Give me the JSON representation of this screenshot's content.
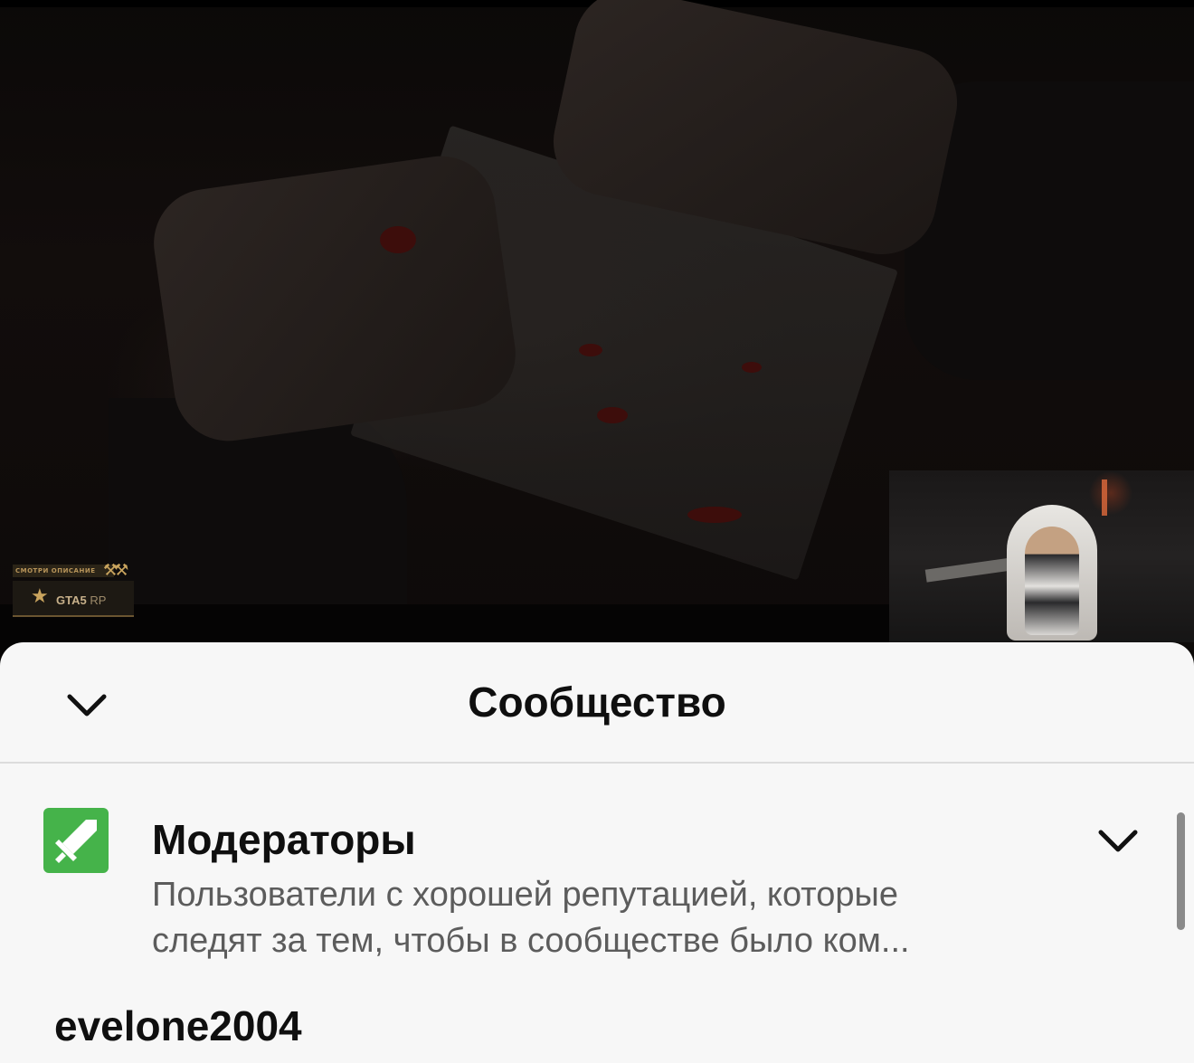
{
  "video": {
    "watermark": {
      "top_text": "СМОТРИ ОПИСАНИЕ",
      "brand": "GTA5",
      "brand_sub": "RP"
    }
  },
  "sheet": {
    "title": "Сообщество",
    "collapse_icon": "chevron-down-icon",
    "section": {
      "icon": "sword-badge-icon",
      "icon_color": "#45b34a",
      "title": "Модераторы",
      "description_line1": "Пользователи с хорошей репутацией, которые",
      "description_line2": "следят за тем, чтобы в сообществе было ком...",
      "expand_icon": "chevron-down-icon"
    },
    "users": [
      {
        "name": "evelone2004"
      }
    ]
  }
}
